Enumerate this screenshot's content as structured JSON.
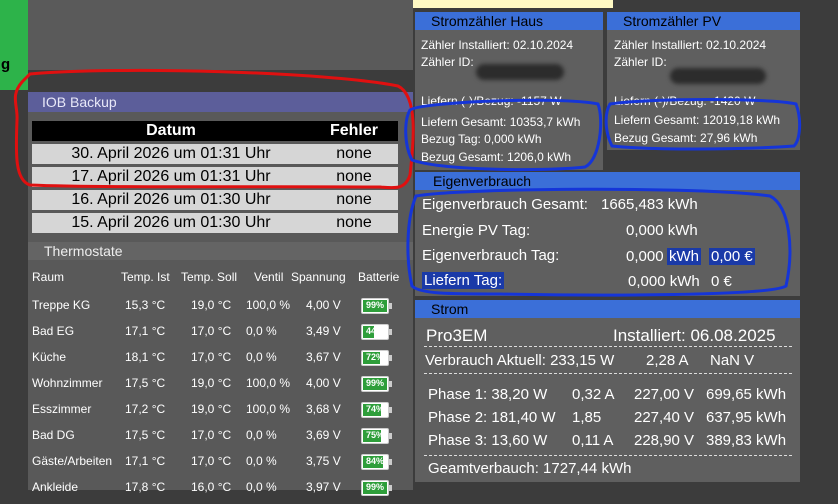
{
  "top_left_tile": {
    "label": "g"
  },
  "iob_backup": {
    "title": "IOB Backup",
    "columns": [
      "Datum",
      "Fehler"
    ],
    "rows": [
      {
        "datum": "30. April 2026 um 01:31 Uhr",
        "fehler": "none"
      },
      {
        "datum": "17. April 2026 um 01:31 Uhr",
        "fehler": "none"
      },
      {
        "datum": "16. April 2026 um 01:30 Uhr",
        "fehler": "none"
      },
      {
        "datum": "15. April 2026 um 01:30 Uhr",
        "fehler": "none"
      }
    ]
  },
  "thermostate": {
    "title": "Thermostate",
    "columns": [
      "Raum",
      "Temp. Ist",
      "Temp. Soll",
      "Ventil",
      "Spannung",
      "Batterie"
    ],
    "rows": [
      {
        "raum": "Treppe KG",
        "ist": "15,3 °C",
        "soll": "19,0 °C",
        "ventil": "100,0 %",
        "spannung": "4,00 V",
        "batterie": "99%",
        "level": 0.99
      },
      {
        "raum": "Bad EG",
        "ist": "17,1 °C",
        "soll": "17,0 °C",
        "ventil": "0,0 %",
        "spannung": "3,49 V",
        "batterie": "44%",
        "level": 0.44
      },
      {
        "raum": "Küche",
        "ist": "18,1 °C",
        "soll": "17,0 °C",
        "ventil": "0,0 %",
        "spannung": "3,67 V",
        "batterie": "72%",
        "level": 0.72
      },
      {
        "raum": "Wohnzimmer",
        "ist": "17,5 °C",
        "soll": "19,0 °C",
        "ventil": "100,0 %",
        "spannung": "4,00 V",
        "batterie": "99%",
        "level": 0.99
      },
      {
        "raum": "Esszimmer",
        "ist": "17,2 °C",
        "soll": "19,0 °C",
        "ventil": "100,0 %",
        "spannung": "3,68 V",
        "batterie": "74%",
        "level": 0.74
      },
      {
        "raum": "Bad DG",
        "ist": "17,5 °C",
        "soll": "17,0 °C",
        "ventil": "0,0 %",
        "spannung": "3,69 V",
        "batterie": "75%",
        "level": 0.75
      },
      {
        "raum": "Gäste/Arbeiten",
        "ist": "17,1 °C",
        "soll": "17,0 °C",
        "ventil": "0,0 %",
        "spannung": "3,75 V",
        "batterie": "84%",
        "level": 0.84
      },
      {
        "raum": "Ankleide",
        "ist": "17,8 °C",
        "soll": "16,0 °C",
        "ventil": "0,0 %",
        "spannung": "3,97 V",
        "batterie": "99%",
        "level": 0.99
      }
    ]
  },
  "stromzaehler_haus": {
    "title": "Stromzähler Haus",
    "installiert": "Zähler Installiert: 02.10.2024",
    "zaehler_id": "Zähler ID:",
    "liefern_bezug": "Liefern (-)/Bezug: -1157 W",
    "liefern_gesamt": "Liefern Gesamt: 10353,7 kWh",
    "bezug_tag": "Bezug Tag: 0,000 kWh",
    "bezug_gesamt": "Bezug Gesamt: 1206,0 kWh"
  },
  "stromzaehler_pv": {
    "title": "Stromzähler PV",
    "installiert": "Zähler Installiert: 02.10.2024",
    "zaehler_id": "Zähler ID:",
    "liefern_bezug": "Liefern (-)/Bezug: -1420 W",
    "liefern_gesamt": "Liefern Gesamt: 12019,18 kWh",
    "bezug_gesamt": "Bezug Gesamt: 27,96 kWh"
  },
  "eigenverbrauch": {
    "title": "Eigenverbrauch",
    "gesamt_label": "Eigenverbrauch Gesamt:",
    "gesamt_value": "1665,483 kWh",
    "energie_pv_label": "Energie PV Tag:",
    "energie_pv_value": "0,000 kWh",
    "tag_label": "Eigenverbrauch Tag:",
    "tag_value": "0,000",
    "tag_unit": "kWh",
    "tag_euro": "0,00 €",
    "liefern_label": "Liefern Tag:",
    "liefern_value": "0,000 kWh",
    "liefern_euro": "0 €"
  },
  "strom": {
    "title": "Strom",
    "device": "Pro3EM",
    "installiert": "Installiert: 06.08.2025",
    "verbrauch_aktuell": "Verbrauch Aktuell: 233,15 W",
    "strom_a": "2,28 A",
    "spannung": "NaN V",
    "phases": [
      {
        "label": "Phase 1: 38,20 W",
        "a": "0,32 A",
        "v": "227,00 V",
        "kwh": "699,65 kWh"
      },
      {
        "label": "Phase 2: 181,40 W",
        "a": "1,85",
        "v": "227,40 V",
        "kwh": "637,95 kWh"
      },
      {
        "label": "Phase 3: 13,60 W",
        "a": "0,11 A",
        "v": "228,90 V",
        "kwh": "389,83 kWh"
      }
    ],
    "gesamt": "Geamtverbauch: 1727,44 kWh"
  },
  "colors": {
    "panel_blue": "#3b6fd8",
    "annotation_red": "#e01010",
    "annotation_blue": "#1535d8",
    "battery_green": "#2e9e3a"
  }
}
